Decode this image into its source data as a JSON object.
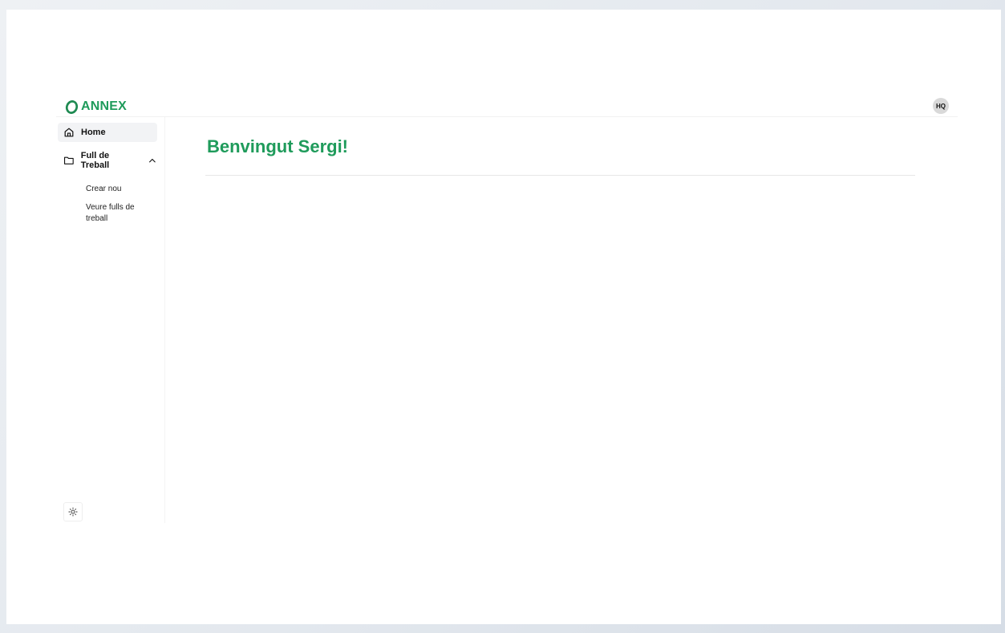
{
  "brand": {
    "name": "ANNEX",
    "color": "#1f9b5b"
  },
  "user": {
    "initials": "HQ"
  },
  "sidebar": {
    "items": [
      {
        "label": "Home",
        "icon": "home-icon",
        "active": true
      },
      {
        "label": "Full de Treball",
        "icon": "folder-icon",
        "expanded": true,
        "children": [
          {
            "label": "Crear nou"
          },
          {
            "label": "Veure fulls de treball"
          }
        ]
      }
    ],
    "theme_toggle_icon": "sun-icon"
  },
  "main": {
    "title": "Benvingut Sergi!"
  }
}
